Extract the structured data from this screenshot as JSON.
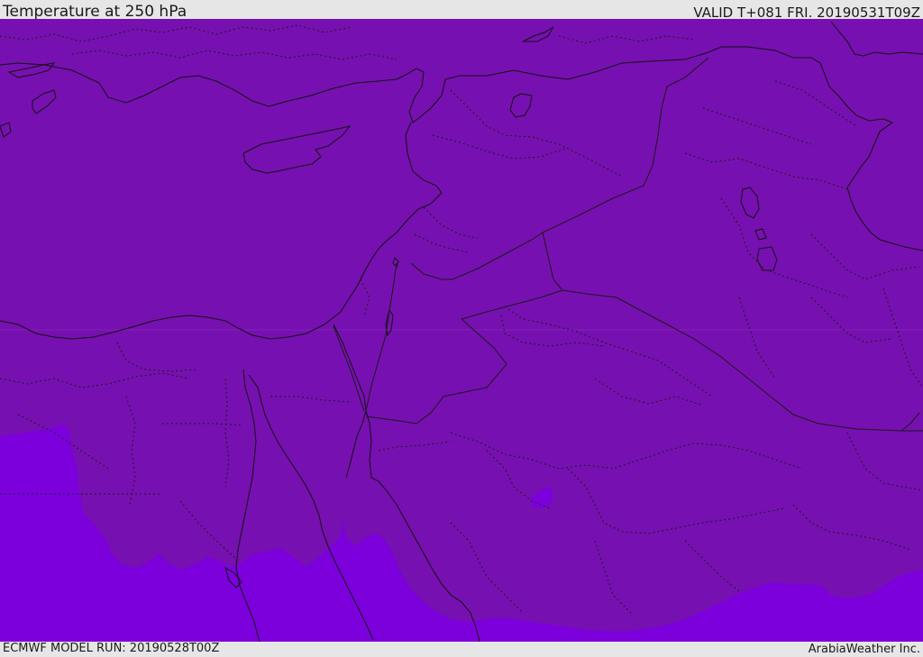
{
  "header": {
    "title": "Temperature at 250 hPa",
    "valid_time": "VALID T+081 FRI. 20190531T09Z"
  },
  "footer": {
    "model_run": "ECMWF MODEL RUN: 20190528T00Z",
    "credit": "ArabiaWeather Inc."
  },
  "map": {
    "colors": {
      "main_fill": "#7710b0",
      "cold_fill": "#7c00dc",
      "coastline": "#111111",
      "border": "#1a1a1a",
      "frame_bg": "#e6e6e6"
    }
  }
}
